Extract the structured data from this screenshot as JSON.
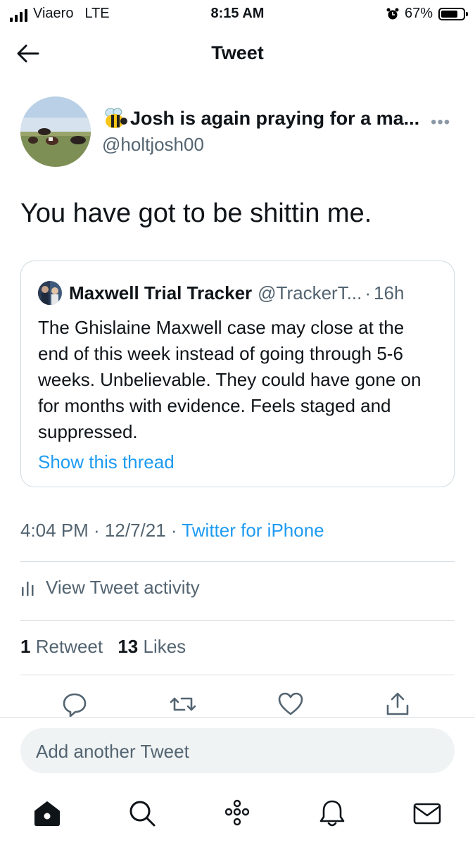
{
  "status_bar": {
    "carrier": "Viaero",
    "network": "LTE",
    "time": "8:15 AM",
    "battery_percent": "67%",
    "battery_level": 0.67,
    "alarm_icon": "alarm-clock-icon"
  },
  "header": {
    "title": "Tweet",
    "back_icon": "back-arrow-icon"
  },
  "tweet": {
    "display_name": "Josh is again praying for a ma...",
    "name_emoji": "bee-icon",
    "handle": "@holtjosh00",
    "more_label": "•••",
    "text": "You have got to be shittin me.",
    "quoted": {
      "name": "Maxwell Trial Tracker",
      "handle": "@TrackerT...",
      "separator": "·",
      "time": "16h",
      "text": "The Ghislaine Maxwell case may close at the end of this week instead of going through 5-6 weeks. Unbelievable. They could have gone on for months with evidence. Feels staged and suppressed.",
      "show_thread": "Show this thread"
    },
    "timestamp": "4:04 PM · 12/7/21 · ",
    "source": "Twitter for iPhone",
    "activity_label": "View Tweet activity",
    "retweet_count": "1",
    "retweet_label": "Retweet",
    "like_count": "13",
    "like_label": "Likes"
  },
  "actions": [
    "reply-icon",
    "retweet-icon",
    "like-icon",
    "share-icon"
  ],
  "compose": {
    "placeholder": "Add another Tweet"
  },
  "tab_bar": [
    "home-icon",
    "search-icon",
    "spaces-icon",
    "notifications-icon",
    "messages-icon"
  ],
  "colors": {
    "accent": "#1d9bf0",
    "secondary_text": "#536471",
    "border": "#cfd9de"
  }
}
